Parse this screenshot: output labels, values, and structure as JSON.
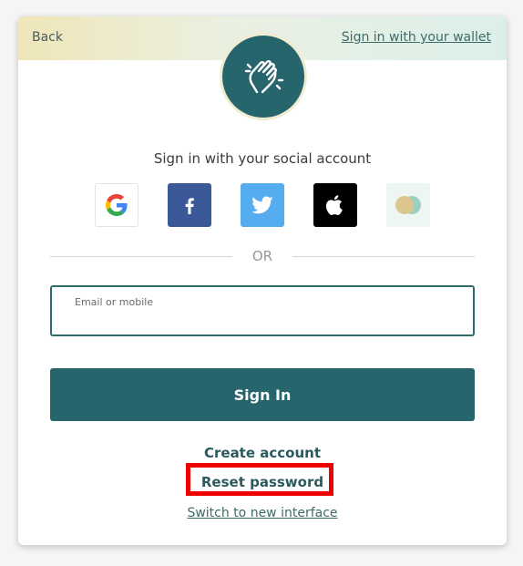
{
  "header": {
    "back_label": "Back",
    "wallet_link": "Sign in with your wallet"
  },
  "logo": {
    "icon": "clapping-hands-icon"
  },
  "social": {
    "title": "Sign in with your social account",
    "providers": [
      {
        "name": "Google",
        "icon": "google-icon",
        "bg": "#ffffff"
      },
      {
        "name": "Facebook",
        "icon": "facebook-icon",
        "bg": "#3b5998"
      },
      {
        "name": "Twitter",
        "icon": "twitter-icon",
        "bg": "#55acee"
      },
      {
        "name": "Apple",
        "icon": "apple-icon",
        "bg": "#000000"
      },
      {
        "name": "Wallet",
        "icon": "wallet-coins-icon",
        "bg": "#eef6f3"
      }
    ]
  },
  "divider": {
    "label": "OR"
  },
  "form": {
    "email_label": "Email or mobile",
    "email_value": "",
    "signin_label": "Sign In"
  },
  "links": {
    "create_account": "Create account",
    "reset_password": "Reset password",
    "switch_interface": "Switch to new interface"
  },
  "colors": {
    "primary": "#26656b",
    "highlight": "#ee0000"
  }
}
